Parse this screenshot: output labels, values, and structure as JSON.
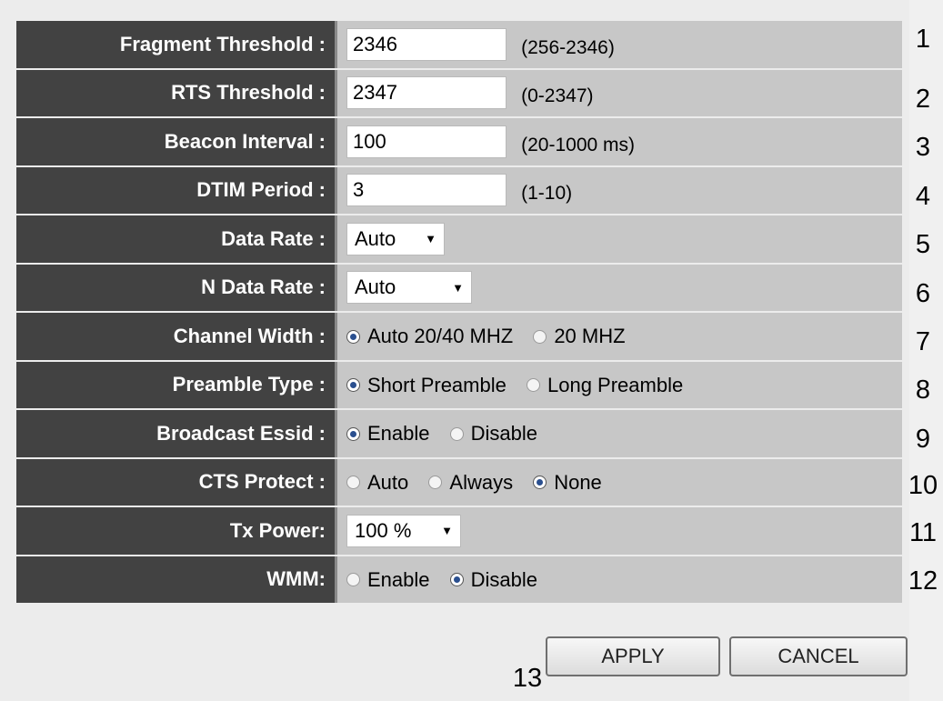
{
  "rows": [
    {
      "label": "Fragment Threshold :",
      "type": "input",
      "value": "2346",
      "hint": "(256-2346)",
      "number": "1"
    },
    {
      "label": "RTS Threshold :",
      "type": "input",
      "value": "2347",
      "hint": "(0-2347)",
      "number": "2"
    },
    {
      "label": "Beacon Interval :",
      "type": "input",
      "value": "100",
      "hint": "(20-1000 ms)",
      "number": "3"
    },
    {
      "label": "DTIM Period :",
      "type": "input",
      "value": "3",
      "hint": "(1-10)",
      "number": "4"
    },
    {
      "label": "Data Rate :",
      "type": "select",
      "value": "Auto",
      "number": "5"
    },
    {
      "label": "N Data Rate :",
      "type": "select",
      "value": "Auto",
      "number": "6"
    },
    {
      "label": "Channel Width :",
      "type": "radio",
      "options": [
        "Auto 20/40 MHZ",
        "20 MHZ"
      ],
      "selected": 0,
      "number": "7"
    },
    {
      "label": "Preamble Type :",
      "type": "radio",
      "options": [
        "Short Preamble",
        "Long Preamble"
      ],
      "selected": 0,
      "number": "8"
    },
    {
      "label": "Broadcast Essid :",
      "type": "radio",
      "options": [
        "Enable",
        "Disable"
      ],
      "selected": 0,
      "number": "9"
    },
    {
      "label": "CTS Protect :",
      "type": "radio",
      "options": [
        "Auto",
        "Always",
        "None"
      ],
      "selected": 2,
      "number": "10"
    },
    {
      "label": "Tx Power:",
      "type": "select",
      "value": "100 %",
      "number": "11"
    },
    {
      "label": "WMM:",
      "type": "radio",
      "options": [
        "Enable",
        "Disable"
      ],
      "selected": 1,
      "number": "12"
    }
  ],
  "buttons": {
    "apply": "APPLY",
    "cancel": "CANCEL",
    "number": "13"
  },
  "colors": {
    "label_bg": "#424242",
    "value_bg": "#c7c7c7",
    "radio_dot": "#2a4f8f"
  }
}
